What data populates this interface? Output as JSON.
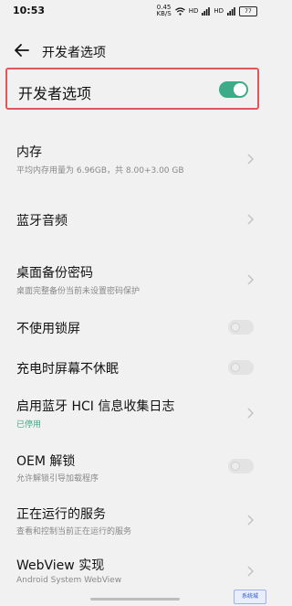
{
  "status_bar": {
    "time": "10:53",
    "network_speed": "0.45",
    "network_speed_unit": "KB/S",
    "signal_left_label": "HD",
    "signal_right_label": "HD",
    "battery": "77",
    "icons": [
      "wifi-icon",
      "signal-icon",
      "signal-icon",
      "battery-icon"
    ]
  },
  "header": {
    "title": "开发者选项"
  },
  "master_toggle": {
    "label": "开发者选项",
    "state": "on",
    "color": "#3bab88"
  },
  "items": [
    {
      "label": "内存",
      "sub": "平均内存用量为 6.96GB，共 8.00+3.00 GB",
      "control": "chevron"
    },
    {
      "label": "蓝牙音频",
      "sub": "",
      "control": "chevron"
    },
    {
      "label": "桌面备份密码",
      "sub": "桌面完整备份当前未设置密码保护",
      "control": "chevron"
    },
    {
      "label": "不使用锁屏",
      "sub": "",
      "control": "toggle",
      "state": "off"
    },
    {
      "label": "充电时屏幕不休眠",
      "sub": "",
      "control": "toggle",
      "state": "off"
    },
    {
      "label": "启用蓝牙 HCI 信息收集日志",
      "sub": "已停用",
      "control": "chevron"
    },
    {
      "label": "OEM 解锁",
      "sub": "允许解锁引导加载程序",
      "control": "toggle",
      "state": "off"
    },
    {
      "label": "正在运行的服务",
      "sub": "查看和控制当前正在运行的服务",
      "control": "chevron"
    },
    {
      "label": "WebView 实现",
      "sub": "Android System WebView",
      "control": "chevron"
    }
  ],
  "watermark": {
    "text": "系统城"
  }
}
